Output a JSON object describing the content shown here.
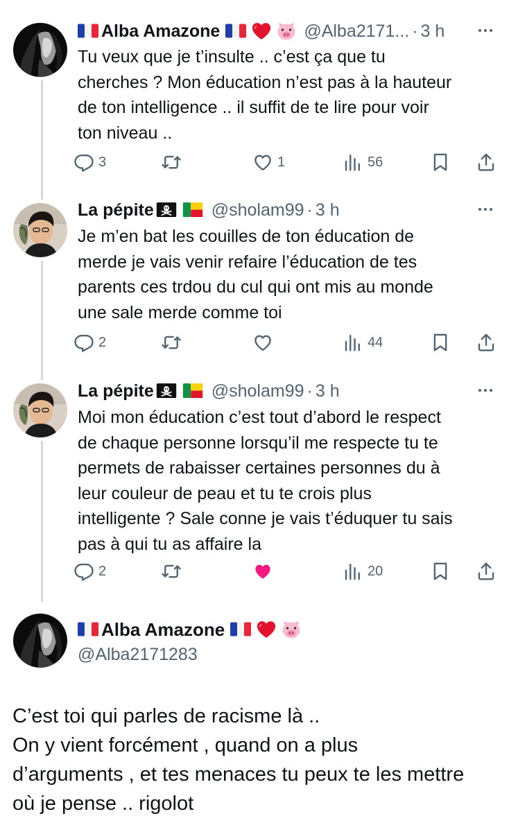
{
  "replies": [
    {
      "author_name": "Alba Amazone",
      "handle": "@Alba2171...",
      "separator": "·",
      "time": "3 h",
      "lines": [
        "Tu veux que je t’insulte .. c’est ça que tu",
        "cherches ? Mon éducation n’est pas à la hauteur",
        "de ton intelligence .. il suffit de te lire pour voir",
        "ton niveau .."
      ],
      "replies_count": "3",
      "likes_count": "1",
      "views_count": "56",
      "liked": false
    },
    {
      "author_name": "La pépite",
      "handle": "@sholam99",
      "separator": "·",
      "time": "3 h",
      "lines": [
        "Je m’en bat les couilles de ton éducation de",
        "merde je vais venir refaire l’éducation de tes",
        "parents ces trdou du cul qui ont mis au monde",
        "une sale merde comme toi"
      ],
      "replies_count": "2",
      "likes_count": "",
      "views_count": "44",
      "liked": false
    },
    {
      "author_name": "La pépite",
      "handle": "@sholam99",
      "separator": "·",
      "time": "3 h",
      "lines": [
        "Moi mon éducation c’est tout d’abord le respect",
        "de chaque personne lorsqu’il me respecte tu te",
        "permets de rabaisser certaines personnes du à",
        "leur couleur de peau et tu te crois plus",
        "intelligente ? Sale conne je vais t’éduquer tu sais",
        "pas à qui tu as affaire la"
      ],
      "replies_count": "2",
      "likes_count": "",
      "views_count": "20",
      "liked": true
    }
  ],
  "main_tweet": {
    "author_name": "Alba Amazone",
    "handle": "@Alba2171283",
    "lines": [
      "C’est toi qui parles de racisme là ..",
      "On y vient forcément , quand on a plus",
      "d’arguments , et tes menaces tu peux te les mettre",
      "où je pense .. rigolot"
    ]
  },
  "colors": {
    "text": "#0f1419",
    "secondary": "#536471",
    "thread_line": "#cfd9de",
    "like_active": "#f91880"
  },
  "icons": [
    "reply-icon",
    "retweet-icon",
    "like-icon",
    "views-icon",
    "bookmark-icon",
    "share-icon",
    "more-icon",
    "flag-france-icon",
    "red-heart-icon",
    "pig-face-icon",
    "pirate-flag-icon",
    "flag-benin-icon"
  ]
}
